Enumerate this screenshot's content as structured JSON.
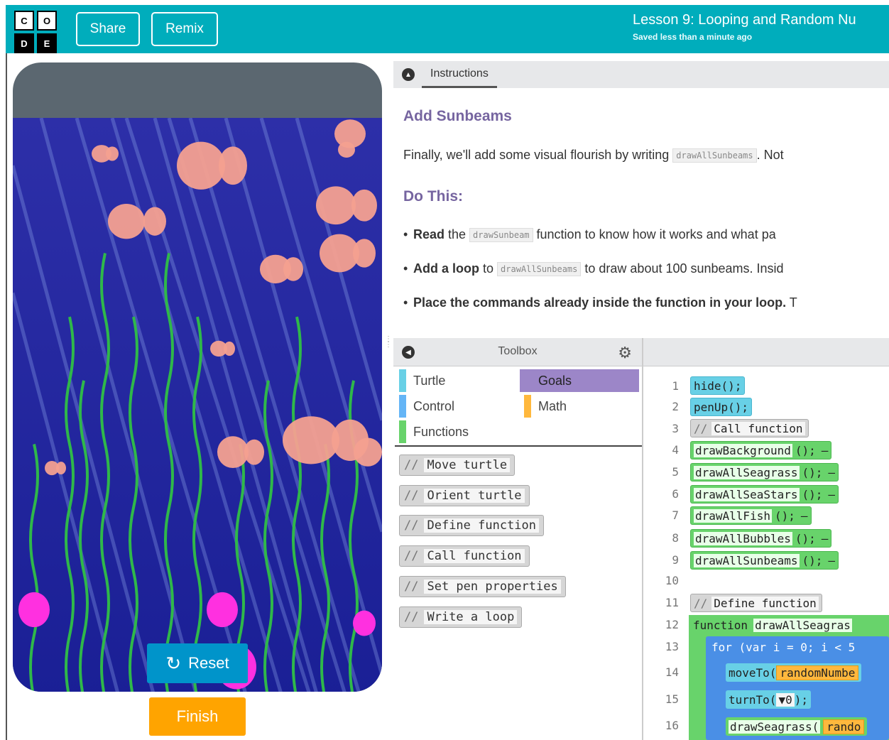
{
  "header": {
    "logo_letters": [
      "C",
      "O",
      "D",
      "E"
    ],
    "share_label": "Share",
    "remix_label": "Remix",
    "lesson_title": "Lesson 9: Looping and Random Nu",
    "saved_status": "Saved less than a minute ago",
    "accent_color": "#00adbc"
  },
  "visualization": {
    "reset_label": "Reset",
    "finish_label": "Finish"
  },
  "instructions": {
    "tab_label": "Instructions",
    "heading": "Add Sunbeams",
    "intro_before": "Finally, we'll add some visual flourish by writing ",
    "intro_code": "drawAllSunbeams",
    "intro_after": ". Not",
    "do_this": "Do This:",
    "bullets": [
      {
        "bold": "Read",
        "before": " the ",
        "code": "drawSunbeam",
        "after": " function to know how it works and what pa"
      },
      {
        "bold": "Add a loop",
        "before": " to ",
        "code": "drawAllSunbeams",
        "after": " to draw about 100 sunbeams. Insid"
      },
      {
        "bold": "Place the commands already inside the function in your loop.",
        "before": " T",
        "code": "",
        "after": ""
      }
    ]
  },
  "toolbox": {
    "title": "Toolbox",
    "categories": [
      {
        "label": "Turtle",
        "color": "#68d0e6"
      },
      {
        "label": "Goals",
        "color": "#9c86c8"
      },
      {
        "label": "Control",
        "color": "#64b5f6"
      },
      {
        "label": "Math",
        "color": "#ffb83d"
      },
      {
        "label": "Functions",
        "color": "#68d36b"
      }
    ],
    "blocks": [
      "Move turtle",
      "Orient turtle",
      "Define function",
      "Call function",
      "Set pen properties",
      "Write a loop"
    ],
    "comment_glyph": "//"
  },
  "code": {
    "line_numbers": [
      "1",
      "2",
      "3",
      "4",
      "5",
      "6",
      "7",
      "8",
      "9",
      "10",
      "11",
      "12",
      "13",
      "14",
      "15",
      "16"
    ],
    "lines": {
      "l1": "hide();",
      "l2": "penUp();",
      "l3": "Call function",
      "l4": "drawBackground",
      "l5": "drawAllSeagrass",
      "l6": "drawAllSeaStars",
      "l7": "drawAllFish",
      "l8": "drawAllBubbles",
      "l9": "drawAllSunbeams",
      "l11": "Define function",
      "l12_kw": "function",
      "l12_name": "drawAllSeagras",
      "l13": "for (var i = 0; i < 5",
      "l14_fn": "moveTo(",
      "l14_arg": "randomNumbe",
      "l15_fn": "turnTo(",
      "l15_arg": "▼0",
      "l15_end": ");",
      "l16_fn": "drawSeagrass(",
      "l16_arg": "rando"
    },
    "call_suffix": "();",
    "remove_glyph": "–"
  }
}
